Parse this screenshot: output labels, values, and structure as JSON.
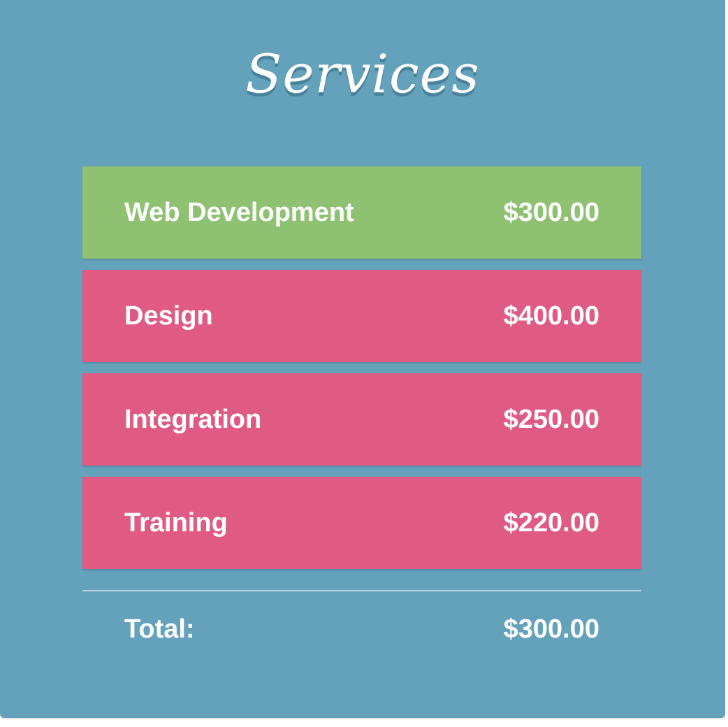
{
  "title": "Services",
  "colors": {
    "background": "#64a1bb",
    "active": "#8fc172",
    "inactive": "#e05b84",
    "text": "#ffffff"
  },
  "services": [
    {
      "name": "Web Development",
      "price": "$300.00",
      "active": true
    },
    {
      "name": "Design",
      "price": "$400.00",
      "active": false
    },
    {
      "name": "Integration",
      "price": "$250.00",
      "active": false
    },
    {
      "name": "Training",
      "price": "$220.00",
      "active": false
    }
  ],
  "total": {
    "label": "Total:",
    "value": "$300.00"
  }
}
